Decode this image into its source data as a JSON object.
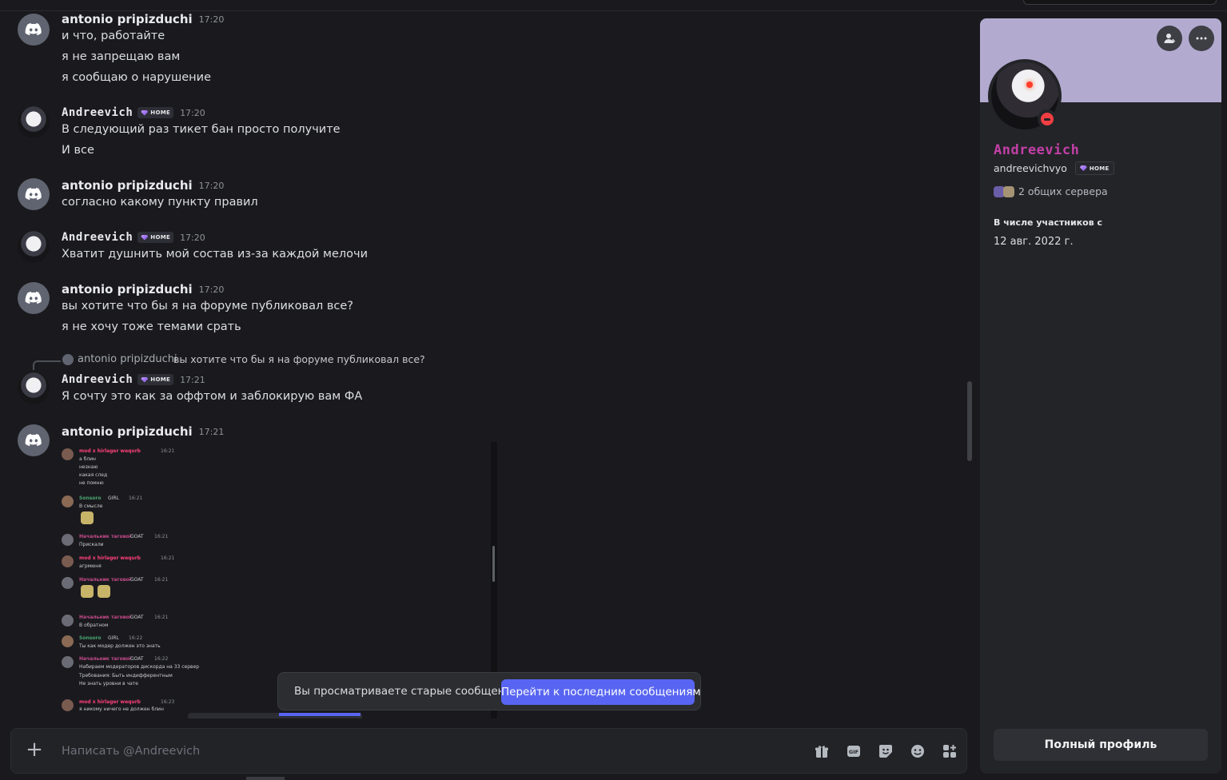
{
  "messages": [
    {
      "user": "antonio pripizduchi",
      "time": "17:20",
      "lines": [
        "и что, работайте",
        "я не запрещаю вам",
        "я сообщаю о нарушение"
      ]
    },
    {
      "user": "Andreevich",
      "tag": "HOME",
      "time": "17:20",
      "lines": [
        "В следующий раз тикет бан просто получите",
        "И все"
      ]
    },
    {
      "user": "antonio pripizduchi",
      "time": "17:20",
      "lines": [
        "согласно какому пункту правил"
      ]
    },
    {
      "user": "Andreevich",
      "tag": "HOME",
      "time": "17:20",
      "lines": [
        "Хватит душнить мой состав из-за каждой мелочи"
      ]
    },
    {
      "user": "antonio pripizduchi",
      "time": "17:20",
      "lines": [
        "вы хотите что бы я на форуме публиковал все?",
        "я не хочу тоже темами срать"
      ]
    },
    {
      "user": "Andreevich",
      "tag": "HOME",
      "time": "17:21",
      "reply": {
        "user": "antonio pripizduchi",
        "text": "вы хотите что бы я на форуме публиковал все?"
      },
      "lines": [
        "Я сочту это как за оффтом и заблокирую вам ФА"
      ]
    },
    {
      "user": "antonio pripizduchi",
      "time": "17:21",
      "lines": []
    }
  ],
  "attachment": {
    "rows": [
      {
        "name": "mod x hirlager wequrb",
        "name_color": "#ff3f7a",
        "time": "16:21",
        "lines": [
          "а блин",
          "незнаю",
          "какая след",
          "не помню"
        ]
      },
      {
        "name": "Sonsoro",
        "name_color": "#4aa56f",
        "tag": "GIRL",
        "time": "16:21",
        "lines": [
          "В смысле"
        ]
      },
      {
        "name": "Начальник тагової",
        "name_color": "#c54a8a",
        "tag": "GOAT",
        "time": "16:21",
        "lines": [
          "Прискали"
        ]
      },
      {
        "name": "mod x hirlager wequrb",
        "name_color": "#ff3f7a",
        "time": "16:21",
        "lines": [
          "агрмюня"
        ]
      },
      {
        "name": "Начальник тагової",
        "name_color": "#c54a8a",
        "tag": "GOAT",
        "time": "16:21",
        "lines": []
      },
      {
        "name": "Начальник тагової",
        "name_color": "#c54a8a",
        "tag": "GOAT",
        "time": "16:21",
        "lines": [
          "В обратном"
        ]
      },
      {
        "name": "Sonsoro",
        "name_color": "#4aa56f",
        "tag": "GIRL",
        "time": "16:22",
        "lines": [
          "Ты как модер должен это знать"
        ]
      },
      {
        "name": "Начальник тагової",
        "name_color": "#c54a8a",
        "tag": "GOAT",
        "time": "16:22",
        "lines": [
          "Набираем модераторов дискорда на 33 сервер",
          "Требования: Быть индифферентным",
          "Не знать уровни в чате"
        ]
      },
      {
        "name": "mod x hirlager wequrb",
        "name_color": "#ff3f7a",
        "time": "16:23",
        "lines": [
          "я никому ничего не должен блин"
        ]
      }
    ]
  },
  "jump_bar": {
    "text": "Вы просматриваете старые сообщения",
    "button": "Перейти к последним сообщениям"
  },
  "composer": {
    "placeholder": "Написать @Andreevich"
  },
  "profile": {
    "display_name": "Andreevich",
    "username": "andreevichvyo",
    "tag": "HOME",
    "mutual_servers": "2 общих сервера",
    "member_since_label": "В числе участников с",
    "member_since": "12 авг. 2022 г.",
    "full_profile_button": "Полный профиль",
    "banner_color": "#b3aad0",
    "name_color": "#c23fa6"
  },
  "colors": {
    "accent": "#5865f2",
    "background": "#1a1a1e",
    "status_dnd": "#f23f43"
  }
}
